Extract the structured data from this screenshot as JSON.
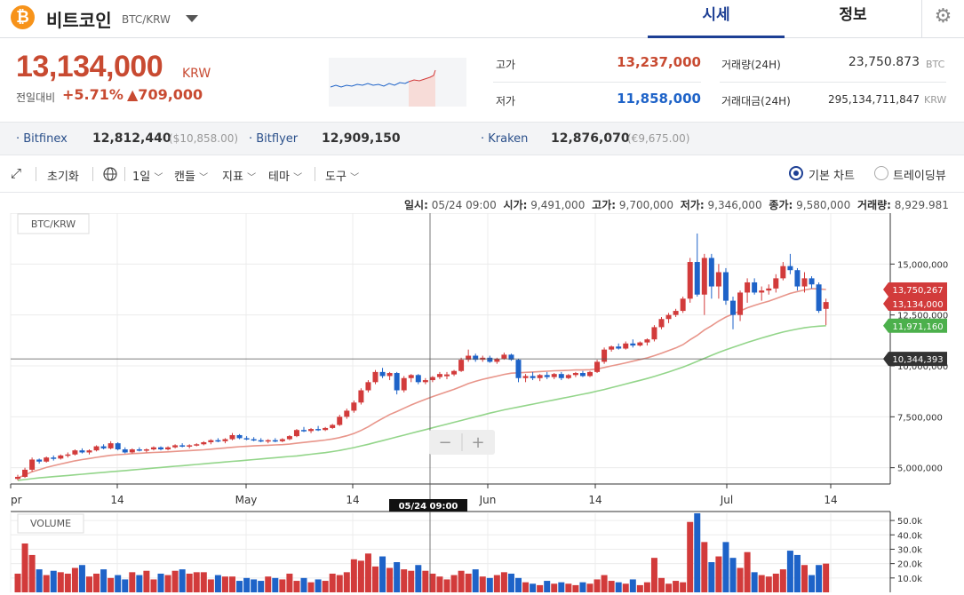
{
  "header": {
    "coin_logo_glyph": "₿",
    "coin_name": "비트코인",
    "pair": "BTC/KRW",
    "tabs": [
      {
        "label": "시세",
        "active": true
      },
      {
        "label": "정보",
        "active": false
      }
    ],
    "settings_icon": "gear-icon"
  },
  "price": {
    "current": "13,134,000",
    "unit": "KRW",
    "change_label": "전일대비",
    "change_pct": "+5.71%",
    "change_amount": "▲709,000"
  },
  "stats": {
    "high_label": "고가",
    "high": "13,237,000",
    "low_label": "저가",
    "low": "11,858,000",
    "volume_label": "거래량(24H)",
    "volume": "23,750.873",
    "volume_unit": "BTC",
    "amount_label": "거래대금(24H)",
    "amount": "295,134,711,847",
    "amount_unit": "KRW"
  },
  "exchanges": [
    {
      "name": "Bitfinex",
      "price": "12,812,440",
      "sub": "($10,858.00)"
    },
    {
      "name": "Bitflyer",
      "price": "12,909,150",
      "sub": ""
    },
    {
      "name": "Kraken",
      "price": "12,876,070",
      "sub": "(€9,675.00)"
    }
  ],
  "toolbar": {
    "expand_icon": "expand-icon",
    "reset": "초기화",
    "globe_icon": "globe-icon",
    "interval": "1일",
    "candle": "캔들",
    "indicator": "지표",
    "theme": "테마",
    "tools": "도구",
    "basic_chart": "기본 차트",
    "tradingview": "트레이딩뷰"
  },
  "ohlc": {
    "time_label": "일시:",
    "time": "05/24 09:00",
    "open_label": "시가:",
    "open": "9,491,000",
    "high_label": "고가:",
    "high": "9,700,000",
    "low_label": "저가:",
    "low": "9,346,000",
    "close_label": "종가:",
    "close": "9,580,000",
    "volume_label": "거래량:",
    "volume": "8,929.981"
  },
  "chart_data": {
    "type": "candlestick",
    "pair_label": "BTC/KRW",
    "volume_label": "VOLUME",
    "x_ticks": [
      "pr",
      "14",
      "May",
      "14",
      "Jun",
      "14",
      "Jul",
      "14"
    ],
    "y_ticks": [
      "15,000,000",
      "12,500,000",
      "10,000,000",
      "7,500,000",
      "5,000,000"
    ],
    "y_tick_values": [
      15000000,
      12500000,
      10000000,
      7500000,
      5000000
    ],
    "ylim": [
      4200000,
      17500000
    ],
    "volume_ticks": [
      "50.0k",
      "40.0k",
      "30.0k",
      "20.0k",
      "10.0k"
    ],
    "volume_tick_values": [
      50000,
      40000,
      30000,
      20000,
      10000
    ],
    "volume_ylim": [
      0,
      55000
    ],
    "crosshair_time": "05/24 09:00",
    "price_tags": [
      {
        "label": "13,750,267",
        "value": 13750267,
        "color": "#d23b3b"
      },
      {
        "label": "13,134,000",
        "value": 13134000,
        "color": "#d23b3b"
      },
      {
        "label": "11,971,160",
        "value": 11971160,
        "color": "#4cb04c"
      },
      {
        "label": "10,344,393",
        "value": 10344393,
        "color": "#333333"
      }
    ],
    "zoom_minus": "−",
    "zoom_plus": "+",
    "colors": {
      "up": "#d23b3b",
      "down": "#1e63c8",
      "ma_short": "#e8958a",
      "ma_long": "#93d58a"
    },
    "candles": [
      [
        4450000,
        4650000,
        4380000,
        4550000
      ],
      [
        4550000,
        5000000,
        4500000,
        4900000
      ],
      [
        4900000,
        5500000,
        4800000,
        5400000
      ],
      [
        5400000,
        5450000,
        5200000,
        5300000
      ],
      [
        5300000,
        5550000,
        5250000,
        5500000
      ],
      [
        5500000,
        5600000,
        5350000,
        5450000
      ],
      [
        5450000,
        5650000,
        5400000,
        5600000
      ],
      [
        5600000,
        5750000,
        5500000,
        5650000
      ],
      [
        5650000,
        5900000,
        5600000,
        5850000
      ],
      [
        5850000,
        5950000,
        5700000,
        5750000
      ],
      [
        5750000,
        5900000,
        5650000,
        5850000
      ],
      [
        5850000,
        6100000,
        5800000,
        6050000
      ],
      [
        6050000,
        6150000,
        5900000,
        5950000
      ],
      [
        5950000,
        6300000,
        5900000,
        6200000
      ],
      [
        6200000,
        6250000,
        5850000,
        5900000
      ],
      [
        5900000,
        6000000,
        5700000,
        5750000
      ],
      [
        5750000,
        5950000,
        5700000,
        5900000
      ],
      [
        5900000,
        6000000,
        5800000,
        5850000
      ],
      [
        5850000,
        5950000,
        5750000,
        5900000
      ],
      [
        5900000,
        6050000,
        5850000,
        6000000
      ],
      [
        6000000,
        6050000,
        5850000,
        5900000
      ],
      [
        5900000,
        6050000,
        5850000,
        6000000
      ],
      [
        6000000,
        6150000,
        5950000,
        6100000
      ],
      [
        6100000,
        6200000,
        6000000,
        6050000
      ],
      [
        6050000,
        6150000,
        5950000,
        6100000
      ],
      [
        6100000,
        6200000,
        6050000,
        6150000
      ],
      [
        6150000,
        6300000,
        6100000,
        6250000
      ],
      [
        6250000,
        6400000,
        6150000,
        6350000
      ],
      [
        6350000,
        6450000,
        6250000,
        6300000
      ],
      [
        6300000,
        6450000,
        6200000,
        6400000
      ],
      [
        6400000,
        6700000,
        6350000,
        6600000
      ],
      [
        6600000,
        6650000,
        6400000,
        6450000
      ],
      [
        6450000,
        6550000,
        6350000,
        6400000
      ],
      [
        6400000,
        6500000,
        6300000,
        6350000
      ],
      [
        6350000,
        6450000,
        6250000,
        6300000
      ],
      [
        6300000,
        6400000,
        6200000,
        6350000
      ],
      [
        6350000,
        6450000,
        6250000,
        6300000
      ],
      [
        6300000,
        6450000,
        6250000,
        6400000
      ],
      [
        6400000,
        6600000,
        6350000,
        6550000
      ],
      [
        6550000,
        6900000,
        6500000,
        6850000
      ],
      [
        6850000,
        7000000,
        6750000,
        6800000
      ],
      [
        6800000,
        6950000,
        6700000,
        6900000
      ],
      [
        6900000,
        7050000,
        6800000,
        6850000
      ],
      [
        6850000,
        7000000,
        6800000,
        6950000
      ],
      [
        6950000,
        7150000,
        6900000,
        7100000
      ],
      [
        7100000,
        7600000,
        7050000,
        7500000
      ],
      [
        7500000,
        7900000,
        7400000,
        7800000
      ],
      [
        7800000,
        8300000,
        7700000,
        8200000
      ],
      [
        8200000,
        8900000,
        8100000,
        8800000
      ],
      [
        8800000,
        9300000,
        8700000,
        9200000
      ],
      [
        9200000,
        9800000,
        9100000,
        9700000
      ],
      [
        9700000,
        9900000,
        9400000,
        9500000
      ],
      [
        9500000,
        9700000,
        9300000,
        9650000
      ],
      [
        9650000,
        9700000,
        8600000,
        8800000
      ],
      [
        8800000,
        9500000,
        8700000,
        9400000
      ],
      [
        9400000,
        9600000,
        9200000,
        9550000
      ],
      [
        9550000,
        9600000,
        9100000,
        9200000
      ],
      [
        9200000,
        9400000,
        9100000,
        9300000
      ],
      [
        9300000,
        9500000,
        9200000,
        9450000
      ],
      [
        9450000,
        9700000,
        9350000,
        9600000
      ],
      [
        9491000,
        9700000,
        9346000,
        9580000
      ],
      [
        9580000,
        9800000,
        9500000,
        9750000
      ],
      [
        9750000,
        10400000,
        9700000,
        10300000
      ],
      [
        10300000,
        10800000,
        10200000,
        10500000
      ],
      [
        10500000,
        10600000,
        10200000,
        10300000
      ],
      [
        10300000,
        10500000,
        10200000,
        10400000
      ],
      [
        10400000,
        10500000,
        10150000,
        10200000
      ],
      [
        10200000,
        10400000,
        10100000,
        10350000
      ],
      [
        10350000,
        10650000,
        10300000,
        10550000
      ],
      [
        10550000,
        10600000,
        10250000,
        10300000
      ],
      [
        10300000,
        10350000,
        9200000,
        9400000
      ],
      [
        9400000,
        9600000,
        9200000,
        9500000
      ],
      [
        9500000,
        9700000,
        9300000,
        9400000
      ],
      [
        9400000,
        9600000,
        9250000,
        9550000
      ],
      [
        9550000,
        9700000,
        9350000,
        9450000
      ],
      [
        9450000,
        9650000,
        9350000,
        9600000
      ],
      [
        9600000,
        9700000,
        9300000,
        9400000
      ],
      [
        9400000,
        9600000,
        9350000,
        9550000
      ],
      [
        9550000,
        9700000,
        9450000,
        9650000
      ],
      [
        9650000,
        9750000,
        9450000,
        9500000
      ],
      [
        9500000,
        9750000,
        9450000,
        9700000
      ],
      [
        9700000,
        10300000,
        9650000,
        10200000
      ],
      [
        10200000,
        10900000,
        10100000,
        10800000
      ],
      [
        10800000,
        11000000,
        10700000,
        10950000
      ],
      [
        10950000,
        11100000,
        10800000,
        10850000
      ],
      [
        10850000,
        11200000,
        10800000,
        11100000
      ],
      [
        11100000,
        11300000,
        10900000,
        11000000
      ],
      [
        11000000,
        11200000,
        10950000,
        11150000
      ],
      [
        11150000,
        11350000,
        11000000,
        11300000
      ],
      [
        11300000,
        12000000,
        11200000,
        11900000
      ],
      [
        11900000,
        12400000,
        11800000,
        12300000
      ],
      [
        12300000,
        12600000,
        12100000,
        12500000
      ],
      [
        12500000,
        12800000,
        12400000,
        12700000
      ],
      [
        12700000,
        13400000,
        12600000,
        13300000
      ],
      [
        13300000,
        15300000,
        13100000,
        15100000
      ],
      [
        15100000,
        16500000,
        13400000,
        13500000
      ],
      [
        13500000,
        15500000,
        12500000,
        15300000
      ],
      [
        15300000,
        15500000,
        13300000,
        13900000
      ],
      [
        13900000,
        15000000,
        13300000,
        14600000
      ],
      [
        14600000,
        14800000,
        13000000,
        13200000
      ],
      [
        13200000,
        13400000,
        11800000,
        12500000
      ],
      [
        12500000,
        13700000,
        12200000,
        13600000
      ],
      [
        13600000,
        14300000,
        13100000,
        14100000
      ],
      [
        14100000,
        14300000,
        13500000,
        13600000
      ],
      [
        13600000,
        13900000,
        13200000,
        13700000
      ],
      [
        13700000,
        14000000,
        13500000,
        13800000
      ],
      [
        13800000,
        14500000,
        13600000,
        14300000
      ],
      [
        14300000,
        15100000,
        14200000,
        14900000
      ],
      [
        14900000,
        15500000,
        14500000,
        14700000
      ],
      [
        14700000,
        14800000,
        13700000,
        13900000
      ],
      [
        13900000,
        14600000,
        13600000,
        14300000
      ],
      [
        14300000,
        14400000,
        13800000,
        14000000
      ],
      [
        14000000,
        14100000,
        12600000,
        12700000
      ],
      [
        12800000,
        13300000,
        12000000,
        13134000
      ]
    ],
    "volumes": [
      13000,
      34000,
      26000,
      16000,
      12000,
      15000,
      14000,
      13000,
      17000,
      19000,
      11000,
      13000,
      16000,
      10000,
      12000,
      9000,
      14000,
      12000,
      15000,
      9000,
      13000,
      12000,
      15000,
      16000,
      13000,
      14000,
      14000,
      9000,
      12000,
      11000,
      11000,
      8000,
      10000,
      9000,
      8000,
      11000,
      10000,
      9000,
      13000,
      8000,
      10000,
      7000,
      9000,
      8000,
      13000,
      12000,
      14000,
      23000,
      22000,
      27000,
      18000,
      25000,
      17000,
      21000,
      16000,
      15000,
      19000,
      15000,
      13000,
      11000,
      9000,
      12000,
      15000,
      13000,
      16000,
      11000,
      10000,
      12000,
      14000,
      13000,
      10000,
      7000,
      6000,
      5000,
      8000,
      6000,
      7000,
      6000,
      5000,
      7000,
      6000,
      9000,
      12000,
      8000,
      7000,
      6000,
      9000,
      5000,
      7000,
      24000,
      10000,
      6000,
      8000,
      7000,
      49000,
      55000,
      35000,
      21000,
      25000,
      35000,
      24000,
      17000,
      28000,
      14000,
      12000,
      11000,
      13000,
      16000,
      29000,
      26000,
      19000,
      12000,
      19000,
      20000
    ],
    "ma_short": [
      4500000,
      4640000,
      4800000,
      4900000,
      5010000,
      5100000,
      5180000,
      5260000,
      5340000,
      5400000,
      5450000,
      5510000,
      5560000,
      5610000,
      5640000,
      5660000,
      5690000,
      5710000,
      5730000,
      5750000,
      5760000,
      5780000,
      5800000,
      5820000,
      5840000,
      5860000,
      5880000,
      5910000,
      5940000,
      5970000,
      6000000,
      6030000,
      6050000,
      6070000,
      6090000,
      6100000,
      6120000,
      6130000,
      6160000,
      6200000,
      6240000,
      6280000,
      6320000,
      6360000,
      6410000,
      6480000,
      6570000,
      6680000,
      6830000,
      7010000,
      7220000,
      7420000,
      7610000,
      7760000,
      7920000,
      8080000,
      8220000,
      8360000,
      8490000,
      8610000,
      8730000,
      8850000,
      8990000,
      9130000,
      9240000,
      9340000,
      9420000,
      9500000,
      9580000,
      9640000,
      9660000,
      9680000,
      9700000,
      9720000,
      9740000,
      9760000,
      9770000,
      9780000,
      9800000,
      9800000,
      9810000,
      9850000,
      9920000,
      10000000,
      10070000,
      10150000,
      10230000,
      10310000,
      10390000,
      10500000,
      10620000,
      10750000,
      10880000,
      11040000,
      11280000,
      11500000,
      11760000,
      11970000,
      12200000,
      12400000,
      12550000,
      12700000,
      12850000,
      12970000,
      13080000,
      13180000,
      13300000,
      13430000,
      13560000,
      13650000,
      13730000,
      13790000,
      13780000,
      13750267
    ],
    "ma_long": [
      4380000,
      4420000,
      4460000,
      4500000,
      4530000,
      4560000,
      4590000,
      4620000,
      4650000,
      4680000,
      4710000,
      4740000,
      4770000,
      4800000,
      4830000,
      4860000,
      4890000,
      4920000,
      4950000,
      4980000,
      5010000,
      5040000,
      5070000,
      5100000,
      5130000,
      5160000,
      5190000,
      5220000,
      5250000,
      5280000,
      5310000,
      5340000,
      5370000,
      5400000,
      5430000,
      5460000,
      5490000,
      5520000,
      5550000,
      5580000,
      5620000,
      5660000,
      5700000,
      5740000,
      5790000,
      5850000,
      5920000,
      5990000,
      6070000,
      6150000,
      6240000,
      6330000,
      6420000,
      6510000,
      6600000,
      6690000,
      6780000,
      6870000,
      6960000,
      7050000,
      7140000,
      7230000,
      7320000,
      7410000,
      7500000,
      7590000,
      7680000,
      7760000,
      7840000,
      7910000,
      7980000,
      8050000,
      8120000,
      8190000,
      8260000,
      8330000,
      8400000,
      8470000,
      8540000,
      8610000,
      8680000,
      8760000,
      8840000,
      8930000,
      9020000,
      9110000,
      9200000,
      9290000,
      9380000,
      9480000,
      9590000,
      9700000,
      9820000,
      9940000,
      10080000,
      10220000,
      10370000,
      10520000,
      10660000,
      10790000,
      10910000,
      11030000,
      11150000,
      11260000,
      11370000,
      11470000,
      11570000,
      11660000,
      11740000,
      11810000,
      11870000,
      11920000,
      11950000,
      11971160
    ]
  }
}
